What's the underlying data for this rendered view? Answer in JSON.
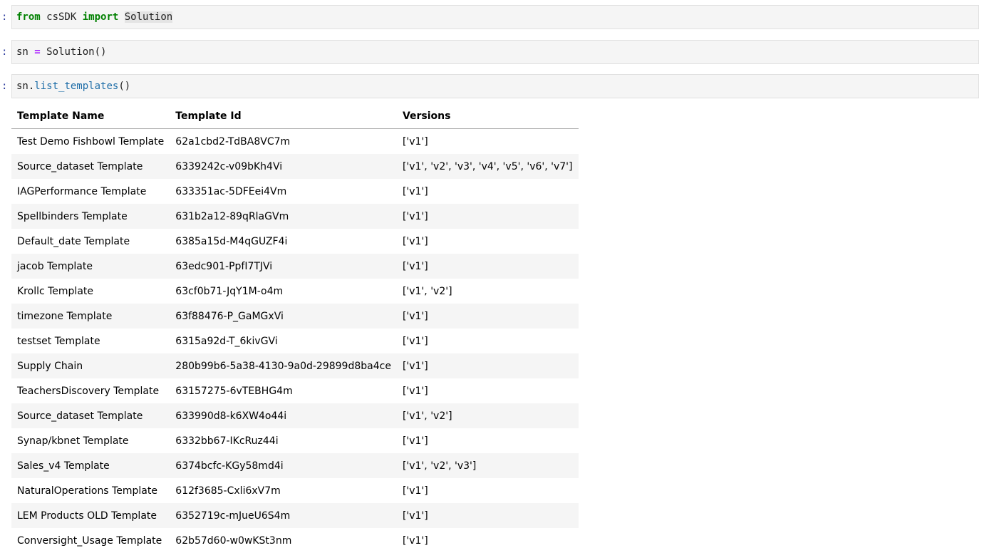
{
  "cells": [
    {
      "prompt": ":",
      "tokens": {
        "kw1": "from",
        "mod": " csSDK ",
        "kw2": "import",
        "sp": " ",
        "name": "Solution"
      }
    },
    {
      "prompt": ":",
      "tokens": {
        "var": "sn ",
        "op": "=",
        "rest": " Solution()"
      }
    },
    {
      "prompt": ":",
      "tokens": {
        "obj": "sn.",
        "fn": "list_templates",
        "paren": "()"
      }
    }
  ],
  "table": {
    "headers": [
      "Template Name",
      "Template Id",
      "Versions"
    ],
    "rows": [
      [
        "Test Demo Fishbowl Template",
        "62a1cbd2-TdBA8VC7m",
        "['v1']"
      ],
      [
        "Source_dataset Template",
        "6339242c-v09bKh4Vi",
        "['v1', 'v2', 'v3', 'v4', 'v5', 'v6', 'v7']"
      ],
      [
        "IAGPerformance Template",
        "633351ac-5DFEei4Vm",
        "['v1']"
      ],
      [
        "Spellbinders Template",
        "631b2a12-89qRlaGVm",
        "['v1']"
      ],
      [
        "Default_date Template",
        "6385a15d-M4qGUZF4i",
        "['v1']"
      ],
      [
        "jacob Template",
        "63edc901-PpfI7TJVi",
        "['v1']"
      ],
      [
        "Krollc Template",
        "63cf0b71-JqY1M-o4m",
        "['v1', 'v2']"
      ],
      [
        "timezone Template",
        "63f88476-P_GaMGxVi",
        "['v1']"
      ],
      [
        "testset Template",
        "6315a92d-T_6kivGVi",
        "['v1']"
      ],
      [
        "Supply Chain",
        "280b99b6-5a38-4130-9a0d-29899d8ba4ce",
        "['v1']"
      ],
      [
        "TeachersDiscovery Template",
        "63157275-6vTEBHG4m",
        "['v1']"
      ],
      [
        "Source_dataset Template",
        "633990d8-k6XW4o44i",
        "['v1', 'v2']"
      ],
      [
        "Synap/kbnet Template",
        "6332bb67-IKcRuz44i",
        "['v1']"
      ],
      [
        "Sales_v4 Template",
        "6374bcfc-KGy58md4i",
        "['v1', 'v2', 'v3']"
      ],
      [
        "NaturalOperations Template",
        "612f3685-Cxli6xV7m",
        "['v1']"
      ],
      [
        "LEM Products OLD Template",
        "6352719c-mJueU6S4m",
        "['v1']"
      ],
      [
        "Conversight_Usage Template",
        "62b57d60-w0wKSt3nm",
        "['v1']"
      ]
    ]
  }
}
